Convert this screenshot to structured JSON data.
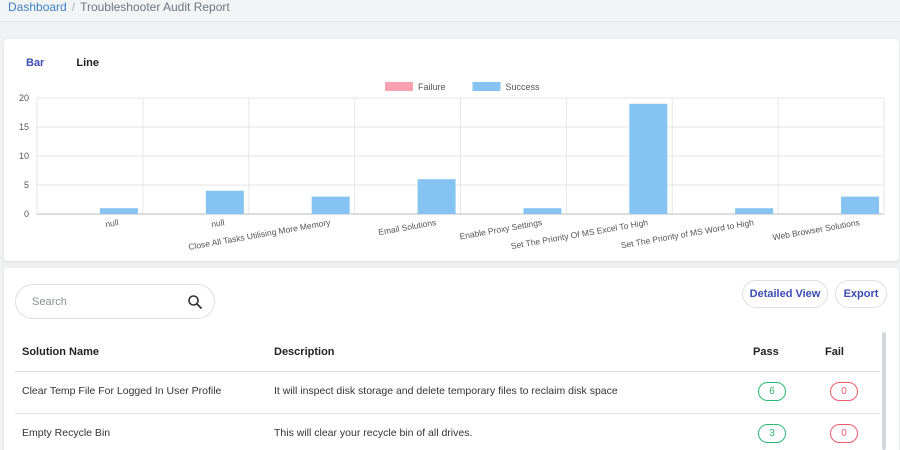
{
  "breadcrumb": {
    "home": "Dashboard",
    "separator": "/",
    "current": "Troubleshooter Audit Report"
  },
  "tabs": [
    {
      "label": "Bar",
      "active": true
    },
    {
      "label": "Line",
      "active": false
    }
  ],
  "chart_data": {
    "type": "bar",
    "categories": [
      "null",
      "null",
      "Close All Tasks Utilising More Memory",
      "Email Solutions",
      "Enable Proxy Settings",
      "Set The Priority Of MS Excel To High",
      "Set The Priority of MS Word to High",
      "Web Browser Solutions"
    ],
    "series": [
      {
        "name": "Failure",
        "color": "#f9a0b1",
        "values": [
          0,
          0,
          0,
          0,
          0,
          0,
          0,
          0
        ]
      },
      {
        "name": "Success",
        "color": "#85c4f2",
        "values": [
          1,
          4,
          3,
          6,
          1,
          19,
          1,
          3
        ]
      }
    ],
    "ylim": [
      0,
      20
    ],
    "yticks": [
      "0",
      "5",
      "10",
      "15",
      "20"
    ],
    "grid": true,
    "legend": "top-center"
  },
  "search": {
    "placeholder": "Search",
    "icon": "search-icon"
  },
  "buttons": {
    "detailed_view": "Detailed View",
    "export": "Export"
  },
  "table": {
    "headers": {
      "name": "Solution Name",
      "description": "Description",
      "pass": "Pass",
      "fail": "Fail"
    },
    "rows": [
      {
        "name": "Clear Temp File For Logged In User Profile",
        "description": "It will inspect disk storage and delete temporary files to reclaim disk space",
        "pass": "6",
        "fail": "0"
      },
      {
        "name": "Empty Recycle Bin",
        "description": "This will clear your recycle bin of all drives.",
        "pass": "3",
        "fail": "0"
      }
    ]
  }
}
